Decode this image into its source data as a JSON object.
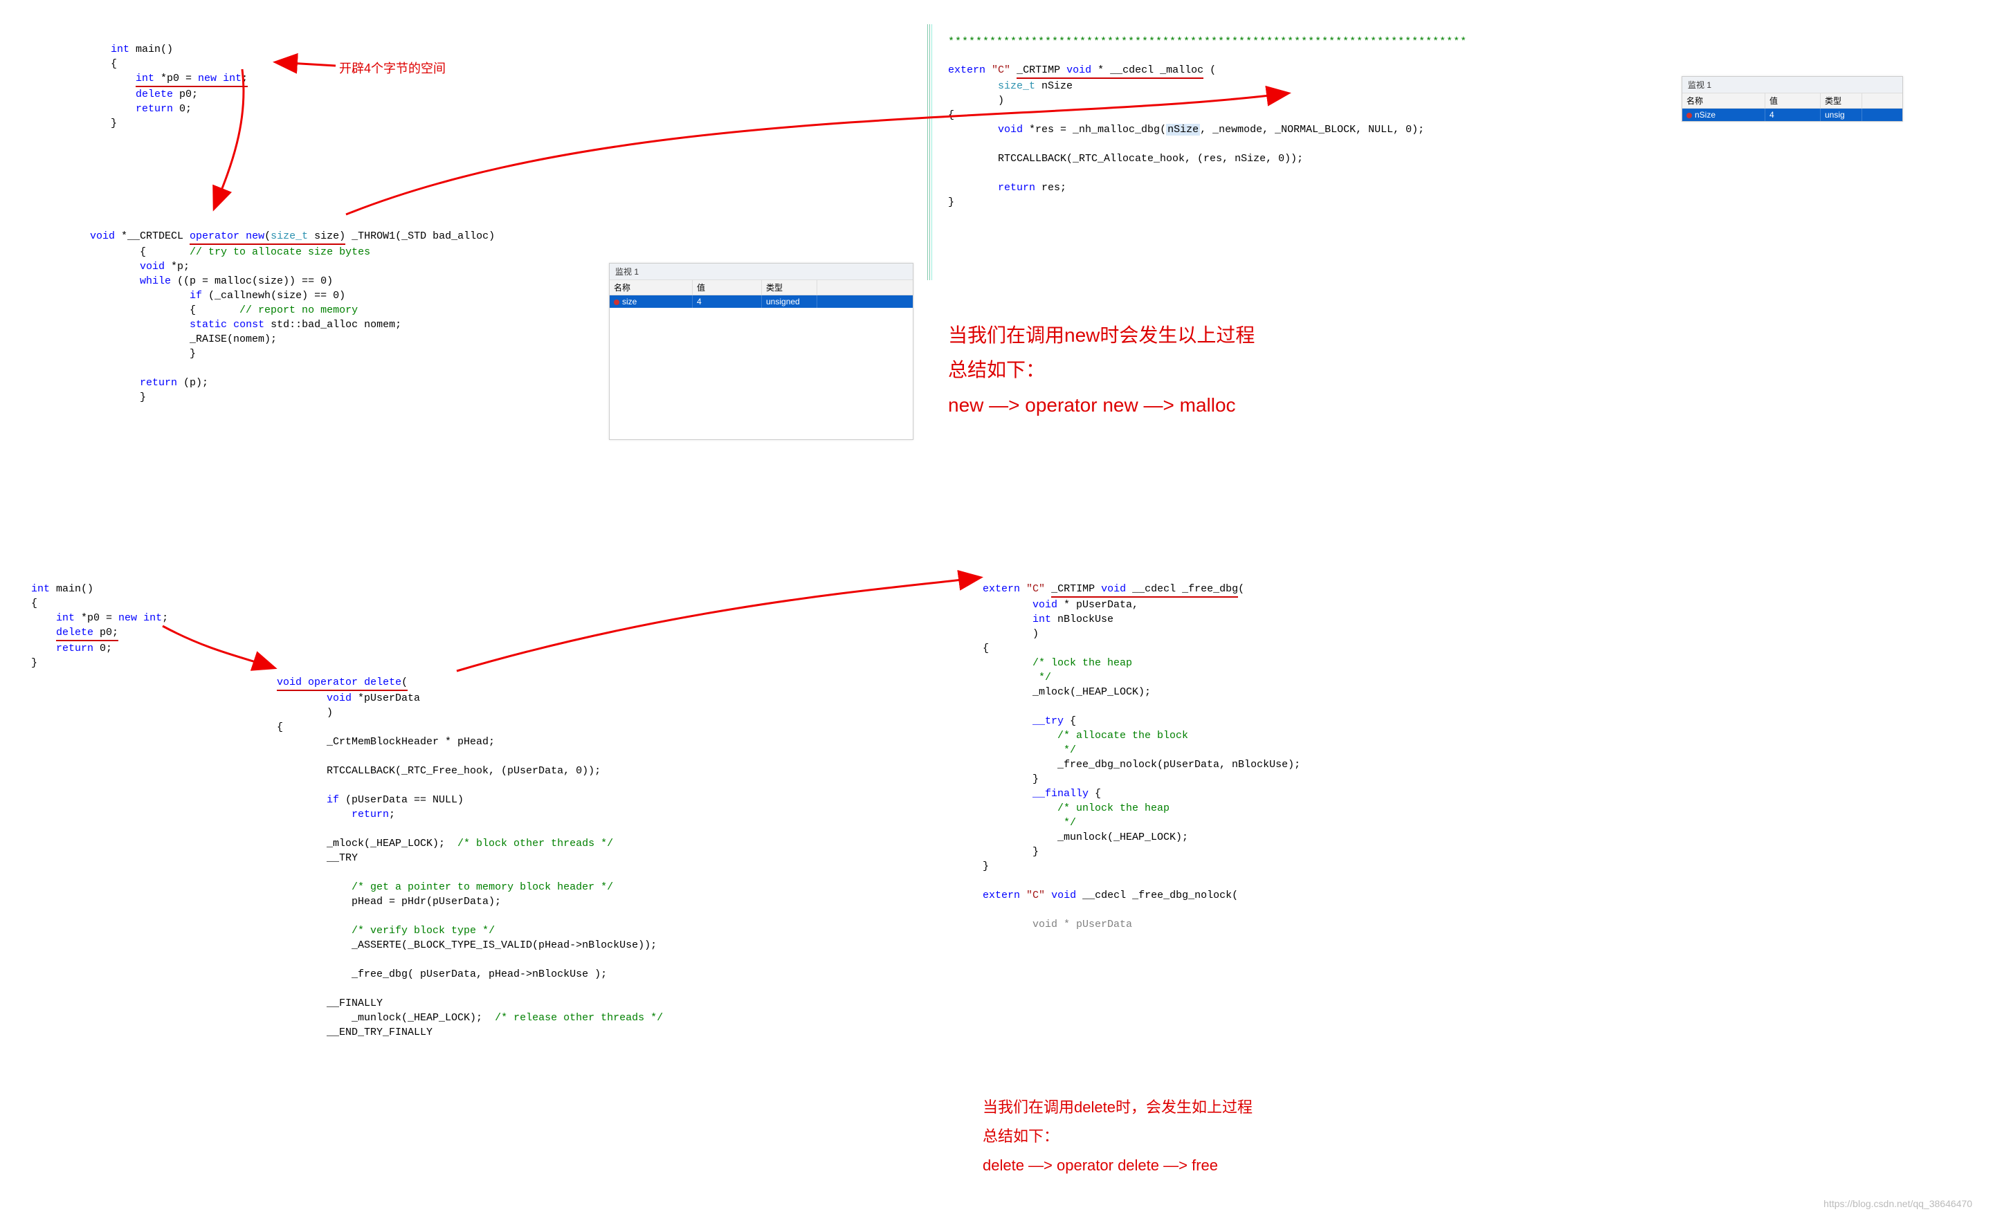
{
  "watermark": "https://blog.csdn.net/qq_38646470",
  "watch1": {
    "title": "监视 1",
    "columns": [
      "名称",
      "值",
      "类型"
    ],
    "name": "size",
    "value": "4",
    "type": "unsigned"
  },
  "watch2": {
    "title": "监视 1",
    "columns": [
      "名称",
      "值",
      "类型"
    ],
    "name": "nSize",
    "value": "4",
    "type": "unsig"
  },
  "annotations": {
    "alloc4": "开辟4个字节的空间",
    "new_summary_l1": "当我们在调用new时会发生以上过程",
    "new_summary_l2": "总结如下：",
    "new_summary_l3": "new  —>  operator new  —>  malloc",
    "del_summary_l1": "当我们在调用delete时，会发生如上过程",
    "del_summary_l2": "总结如下：",
    "del_summary_l3": "delete  —>  operator delete  —>  free"
  },
  "code": {
    "main1": {
      "l1": "int main()",
      "l2": "{",
      "l3": "    int *p0 = new int;",
      "l4": "    delete p0;",
      "l5": "    return 0;",
      "l6": "}"
    },
    "opnew": {
      "sig_pre": "void *__CRTDECL ",
      "sig_fn": "operator new",
      "sig_args": "(size_t size)",
      "sig_throw": " _THROW1(_STD bad_alloc)",
      "l_try": "        {       // try to allocate size bytes",
      "l_voidp": "        void *p;",
      "l_while": "        while ((p = malloc(size)) == 0)",
      "l_if": "                if (_callnewh(size) == 0)",
      "l_report": "                {       // report no memory",
      "l_static": "                static const std::bad_alloc nomem;",
      "l_raise": "                _RAISE(nomem);",
      "l_closebr": "                }",
      "l_ret": "        return (p);",
      "l_close": "        }"
    },
    "malloc": {
      "stars": "***************************************************************************",
      "sig": "extern \"C\" _CRTIMP void * __cdecl _malloc (",
      "l_size": "        size_t nSize",
      "l_close": "        )",
      "l_open": "{",
      "l_res": "        void *res = _nh_malloc_dbg(",
      "l_res2": ", _newmode, _NORMAL_BLOCK, NULL, 0);",
      "l_nSize": "nSize",
      "l_rtc": "        RTCCALLBACK(_RTC_Allocate_hook, (res, nSize, 0));",
      "l_ret": "        return res;",
      "l_end": "}"
    },
    "main2": {
      "l1": "int main()",
      "l2": "{",
      "l3": "    int *p0 = new int;",
      "l4": "    delete p0;",
      "l5": "    return 0;",
      "l6": "}"
    },
    "opdel": {
      "sig": "void operator delete(",
      "l_arg1": "        void *pUserData",
      "l_close": "        )",
      "l_open": "{",
      "l_phead": "        _CrtMemBlockHeader * pHead;",
      "l_rtc": "        RTCCALLBACK(_RTC_Free_hook, (pUserData, 0));",
      "l_if": "        if (pUserData == NULL)",
      "l_return": "            return;",
      "l_mlock": "        _mlock(_HEAP_LOCK);  /* block other threads */",
      "l_try": "        __TRY",
      "l_getptr": "            /* get a pointer to memory block header */",
      "l_phdr": "            pHead = pHdr(pUserData);",
      "l_verify": "            /* verify block type */",
      "l_asserte": "            _ASSERTE(_BLOCK_TYPE_IS_VALID(pHead->nBlockUse));",
      "l_free": "            _free_dbg( pUserData, pHead->nBlockUse );",
      "l_finally": "        __FINALLY",
      "l_munlock": "            _munlock(_HEAP_LOCK);  /* release other threads */",
      "l_endtry": "        __END_TRY_FINALLY"
    },
    "freedbg": {
      "sig": "extern \"C\" _CRTIMP void __cdecl _free_dbg(",
      "l_arg1": "        void * pUserData,",
      "l_arg2": "        int nBlockUse",
      "l_close": "        )",
      "l_open": "{",
      "l_lock_c": "        /* lock the heap",
      "l_lock_c2": "         */",
      "l_mlock": "        _mlock(_HEAP_LOCK);",
      "l_try": "        __try {",
      "l_alloc_c": "            /* allocate the block",
      "l_alloc_c2": "             */",
      "l_free": "            _free_dbg_nolock(pUserData, nBlockUse);",
      "l_tryclose": "        }",
      "l_finally": "        __finally {",
      "l_unlock_c": "            /* unlock the heap",
      "l_unlock_c2": "             */",
      "l_munlock": "            _munlock(_HEAP_LOCK);",
      "l_finclose": "        }",
      "l_end": "}",
      "sig2": "extern \"C\" void __cdecl _free_dbg_nolock(",
      "l_voidp": "        void * pUserData"
    }
  }
}
